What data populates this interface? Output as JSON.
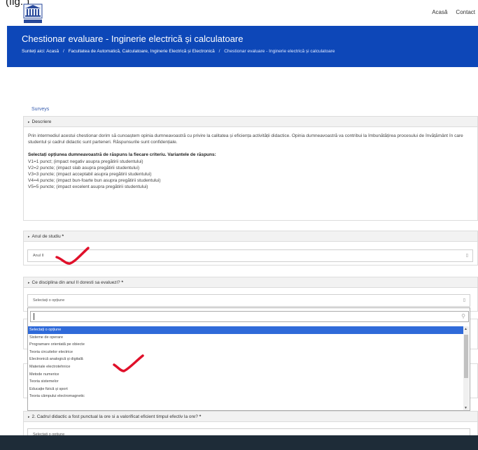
{
  "caption_fragment": "(fig. )",
  "nav": {
    "home": "Acasă",
    "contact": "Contact"
  },
  "banner": {
    "title": "Chestionar evaluare - Inginerie electrică și calculatoare",
    "breadcrumb_label": "Sunteți aici:",
    "crumbs": [
      "Acasă",
      "Facultatea de Automatică, Calculatoare, Inginerie Electrică și Electronică",
      "Chestionar evaluare - Inginerie electrică și calculatoare"
    ]
  },
  "surveys_link": "Surveys",
  "description": {
    "header": "Descriere",
    "paragraph": "Prin intermediul acestui chestionar dorim să cunoaștem opinia dumneavoastră cu privire la calitatea și eficiența activității didactice. Opinia dumneavoastră va contribui la îmbunătățirea procesului de învățământ în care studentul și cadrul didactic sunt parteneri. Răspunsurile sunt confidențiale.",
    "options_title": "Selectați opțiunea dumneavoastră de răspuns la fiecare criteriu. Variantele de răspuns:",
    "options": [
      "V1=1 punct; (impact negativ asupra pregătirii studentului)",
      "V2=2 puncte; (impact slab asupra pregătirii studentului)",
      "V3=3 puncte; (impact acceptabil asupra pregătirii studentului)",
      "V4=4 puncte; (impact bun-foarte bun asupra pregătirii studentului)",
      "V5=5 puncte; (impact excelent asupra pregătirii studentului)"
    ]
  },
  "year": {
    "header": "Anul de studiu",
    "required": "*",
    "value": "Anul II"
  },
  "discipline": {
    "header": "Ce disciplina din anul II doresti sa evaluezi?",
    "required": "*",
    "value": "Selectați o opțiune"
  },
  "dropdown": {
    "search_value": "",
    "options": [
      "Selectați o opțiune",
      "Sisteme de operare",
      "Programare orientată pe obiecte",
      "Teoria circuitelor electrice",
      "Electronică analogică și digitală",
      "Materiale electrotehnice",
      "Metode numerice",
      "Teoria sistemelor",
      "Educație fizică și sport",
      "Teoria câmpului electromagnetic"
    ]
  },
  "question2": {
    "header": "2. Cadrul didactic a fost punctual la ore si a valorificat eficient timpul efectiv la ore?",
    "required": "*",
    "value": "Selectați o opțiune"
  },
  "colors": {
    "banner": "#0d47b8",
    "highlight": "#2f6ad9",
    "annotation": "#e0102a",
    "bottom_bar": "#1e2c38"
  }
}
